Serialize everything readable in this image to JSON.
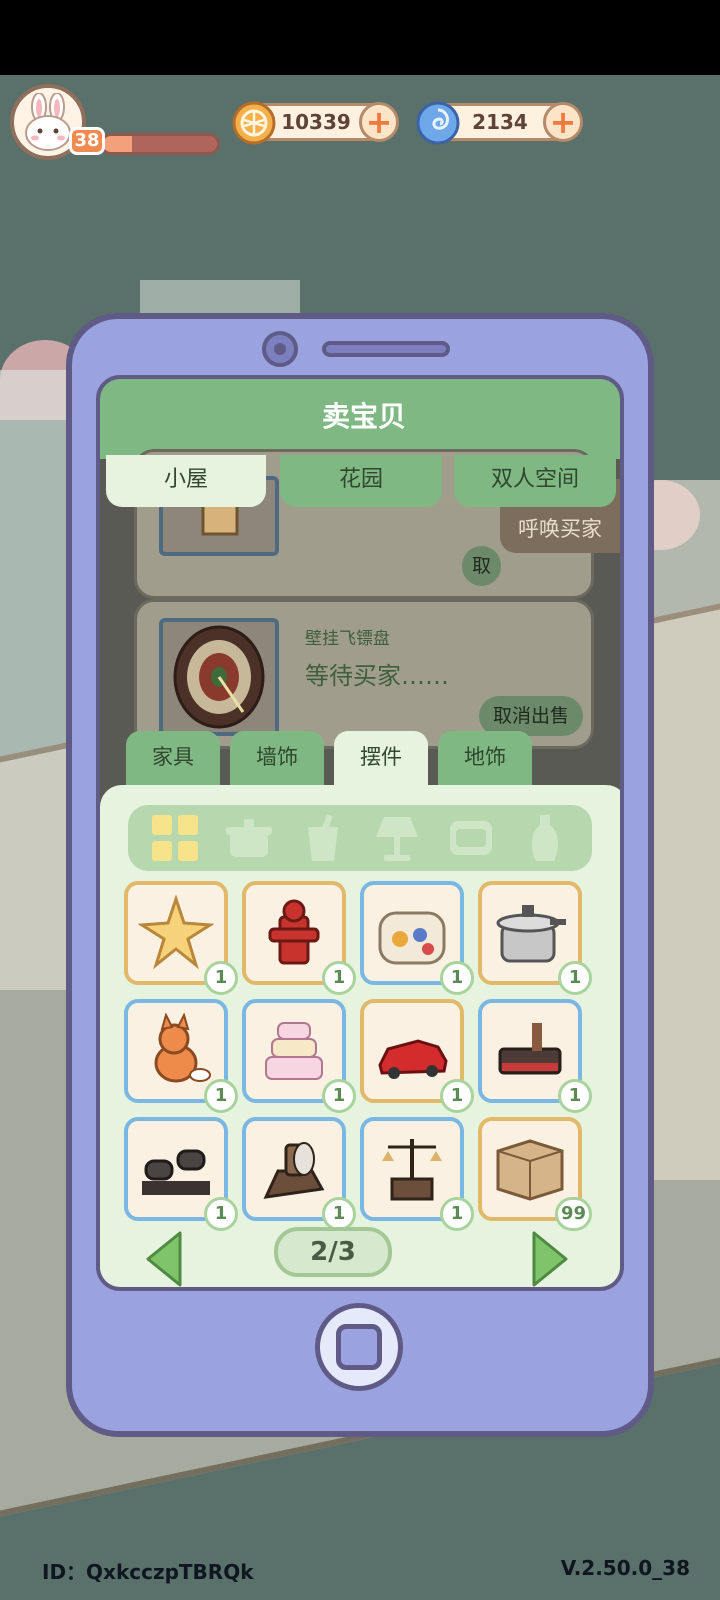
{
  "hud": {
    "level": "38",
    "xp_fraction": 0.25,
    "coins": "10339",
    "gems": "2134"
  },
  "panel": {
    "title": "卖宝贝",
    "tabs_top": [
      "小屋",
      "花园",
      "双人空间"
    ],
    "summon_label": "呼唤买家",
    "listing": {
      "name": "壁挂飞镖盘",
      "status": "等待买家……",
      "cancel": "取消出售",
      "cancel_partial": "取"
    },
    "category_tabs": [
      "家具",
      "墙饰",
      "摆件",
      "地饰"
    ],
    "filter_icons": [
      "grid-icon",
      "pot-icon",
      "cup-icon",
      "lamp-icon",
      "pillow-icon",
      "vase-icon"
    ],
    "items": [
      {
        "icon": "star-ornament",
        "count": "1",
        "frame": "gold"
      },
      {
        "icon": "fire-hydrant",
        "count": "1",
        "frame": "gold"
      },
      {
        "icon": "cat-capsule",
        "count": "1",
        "frame": "blue"
      },
      {
        "icon": "pressure-cooker",
        "count": "1",
        "frame": "gold"
      },
      {
        "icon": "fox-figurine",
        "count": "1",
        "frame": "blue"
      },
      {
        "icon": "cake-tower",
        "count": "1",
        "frame": "blue"
      },
      {
        "icon": "red-sports-car",
        "count": "1",
        "frame": "gold"
      },
      {
        "icon": "toy-workbench",
        "count": "1",
        "frame": "blue"
      },
      {
        "icon": "binoculars",
        "count": "1",
        "frame": "blue"
      },
      {
        "icon": "telescope-stand",
        "count": "1",
        "frame": "blue"
      },
      {
        "icon": "balance-scale",
        "count": "1",
        "frame": "blue"
      },
      {
        "icon": "cardboard-box",
        "count": "99",
        "frame": "gold"
      }
    ],
    "pager": "2/3"
  },
  "footer": {
    "id": "ID：QxkcczpTBRQk",
    "version": "V.2.50.0_38"
  },
  "colors": {
    "green": "#7fb883",
    "panel_bg": "#e5f3df",
    "phone": "#9aa3e0",
    "accent_orange": "#f07a3c"
  }
}
